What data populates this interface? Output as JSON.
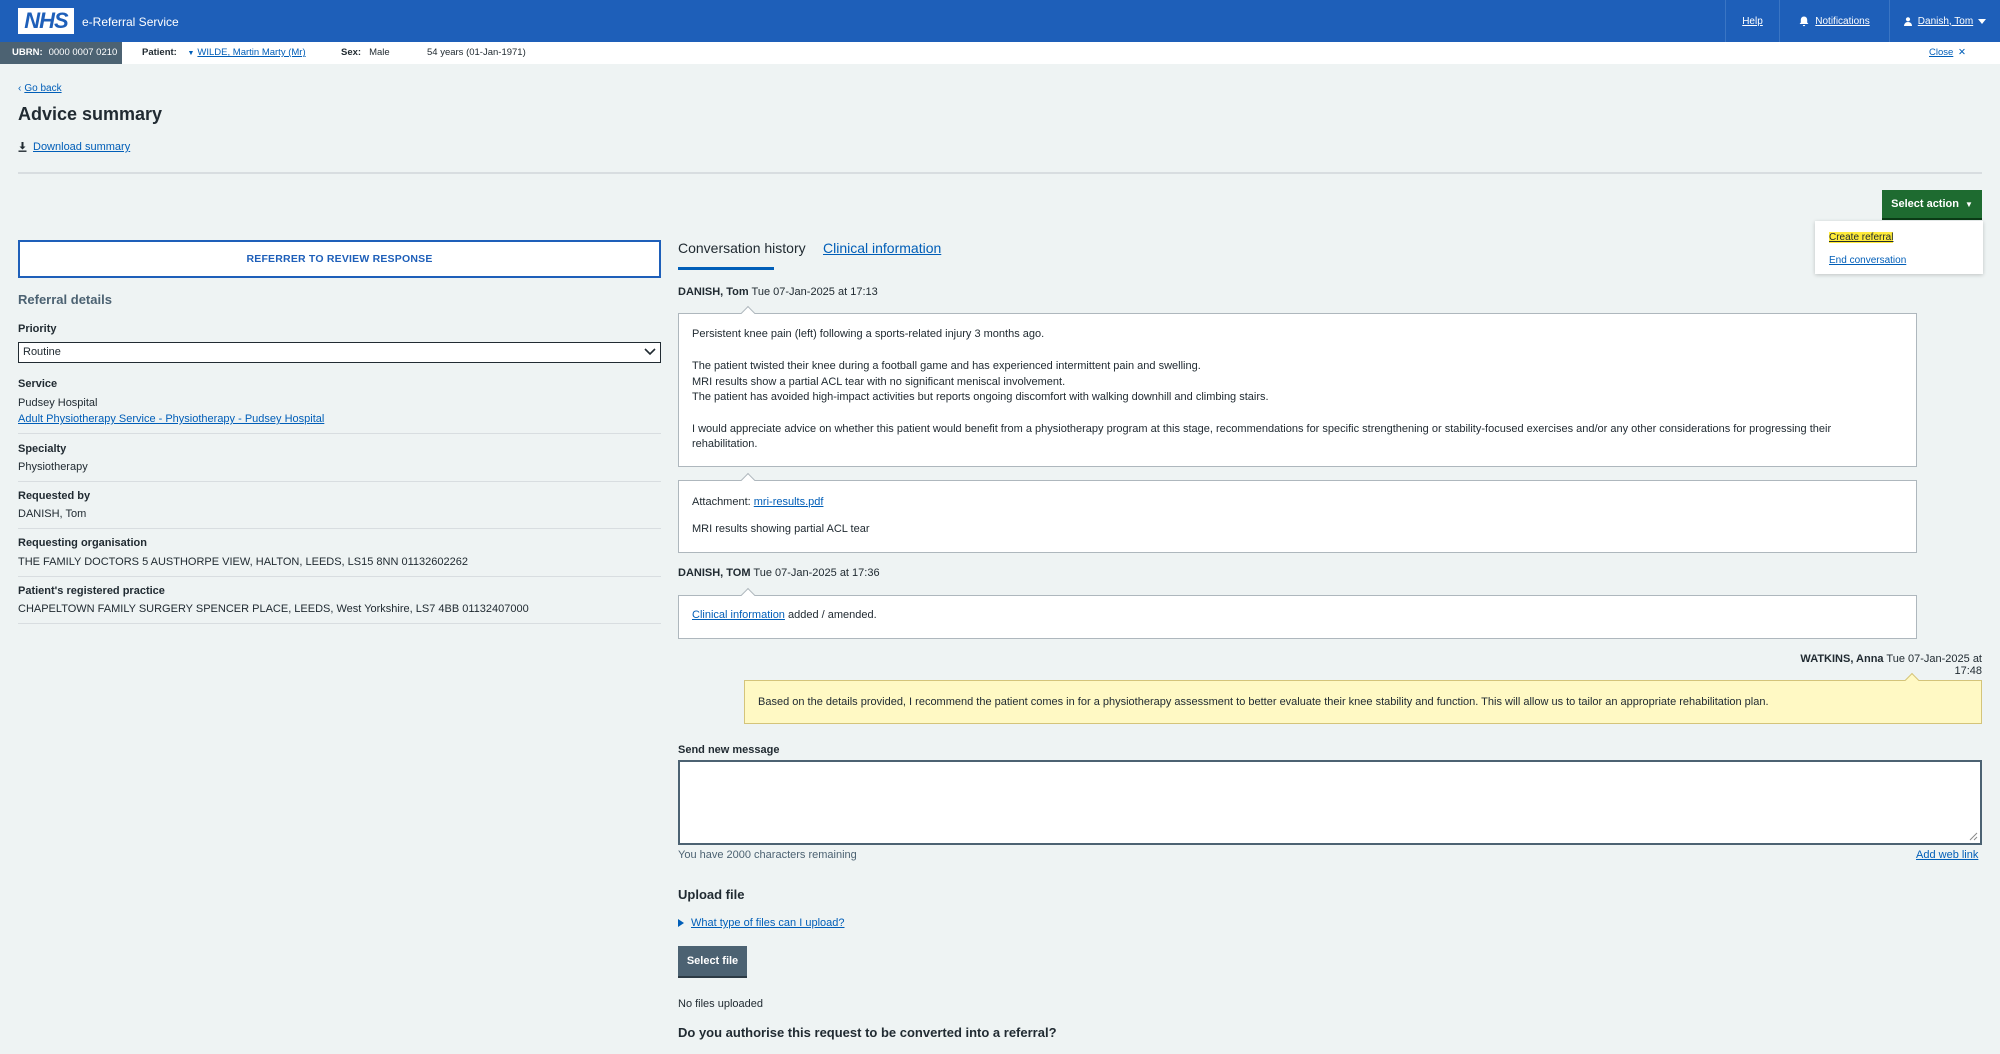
{
  "header": {
    "logo": "NHS",
    "service_name": "e-Referral Service",
    "help": "Help",
    "notifications": "Notifications",
    "user": "Danish, Tom"
  },
  "patient_bar": {
    "ubrn_label": "UBRN:",
    "ubrn_value": "0000 0007 0210",
    "patient_label": "Patient:",
    "patient_name": "WILDE, Martin Marty (Mr)",
    "sex_label": "Sex:",
    "sex_value": "Male",
    "age": "54 years (01-Jan-1971)",
    "close": "Close"
  },
  "page": {
    "back": "Go back",
    "title": "Advice summary",
    "download": "Download summary"
  },
  "actions": {
    "select_action": "Select action",
    "menu": [
      "Create referral",
      "End conversation"
    ]
  },
  "left": {
    "status_box": "REFERRER TO REVIEW RESPONSE",
    "section_title": "Referral details",
    "priority_label": "Priority",
    "priority_value": "Routine",
    "service_label": "Service",
    "service_provider": "Pudsey Hospital",
    "service_link": "Adult Physiotherapy Service - Physiotherapy - Pudsey Hospital",
    "specialty_label": "Specialty",
    "specialty_value": "Physiotherapy",
    "requested_by_label": "Requested by",
    "requested_by_value": "DANISH, Tom",
    "req_org_label": "Requesting organisation",
    "req_org_value": "THE FAMILY DOCTORS 5 AUSTHORPE VIEW, HALTON, LEEDS, LS15 8NN 01132602262",
    "practice_label": "Patient's registered practice",
    "practice_value": "CHAPELTOWN FAMILY SURGERY SPENCER PLACE, LEEDS, West Yorkshire, LS7 4BB 01132407000"
  },
  "tabs": {
    "active": "Conversation history",
    "other": "Clinical information"
  },
  "conversation": {
    "msg1_author": "DANISH, Tom",
    "msg1_time": "Tue 07-Jan-2025 at 17:13",
    "msg1_lines": [
      "Persistent knee pain (left) following a sports-related injury 3 months ago.",
      "The patient twisted their knee during a football game and has experienced intermittent pain and swelling.",
      "MRI results show a partial ACL tear with no significant meniscal involvement.",
      "The patient has avoided high-impact activities but reports ongoing discomfort with walking downhill and climbing stairs.",
      "I would appreciate advice on whether this patient would benefit from a physiotherapy program at this stage, recommendations for specific strengthening or stability-focused exercises and/or any other considerations for progressing their",
      "rehabilitation."
    ],
    "attachment_label": "Attachment:",
    "attachment_file": "mri-results.pdf",
    "attachment_desc": "MRI results showing partial ACL tear",
    "msg2_author": "DANISH, TOM",
    "msg2_time": "Tue 07-Jan-2025 at 17:36",
    "msg2_link": "Clinical information",
    "msg2_text": "added / amended.",
    "reply_author": "WATKINS, Anna",
    "reply_time": "Tue 07-Jan-2025 at 17:48",
    "reply_text": "Based on the details provided, I recommend the patient comes in for a physiotherapy assessment to better evaluate their knee stability and function. This will allow us to tailor an appropriate rehabilitation plan."
  },
  "compose": {
    "label": "Send new message",
    "chars_remaining": "You have 2000 characters remaining",
    "add_web_link": "Add web link",
    "upload_heading": "Upload file",
    "file_types_link": "What type of files can I upload?",
    "select_file": "Select file",
    "no_files": "No files uploaded",
    "authorise_question": "Do you authorise this request to be converted into a referral?"
  }
}
